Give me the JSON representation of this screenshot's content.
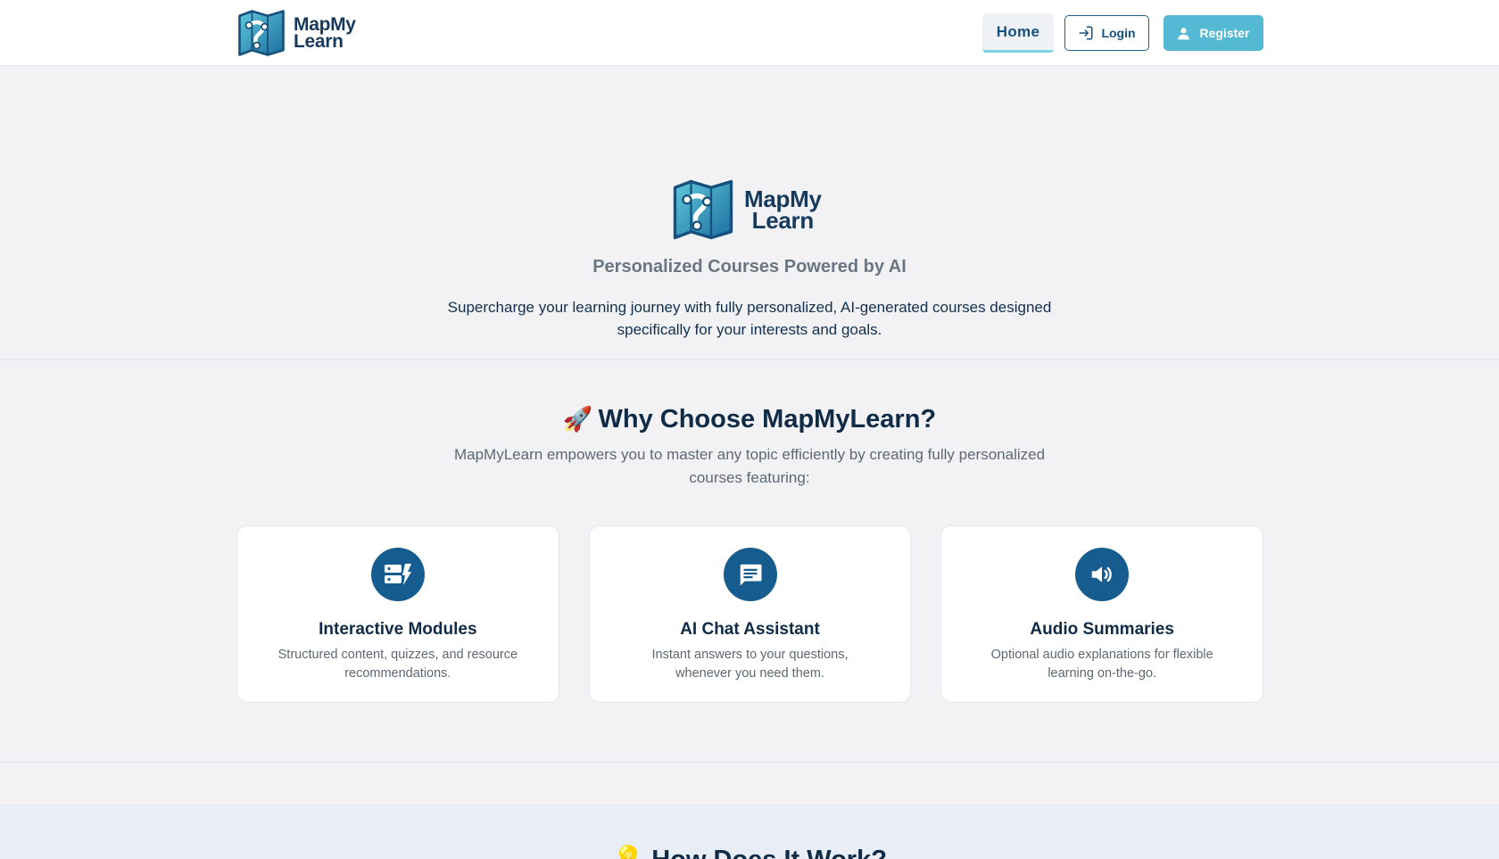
{
  "brand": {
    "name_line1": "MapMy",
    "name_line2": "Learn"
  },
  "nav": {
    "home": "Home",
    "login": "Login",
    "register": "Register"
  },
  "hero": {
    "tagline": "Personalized Courses Powered by AI",
    "description": "Supercharge your learning journey with fully personalized, AI-generated courses designed specifically for your interests and goals."
  },
  "why": {
    "emoji": "🚀",
    "title": "Why Choose MapMyLearn?",
    "description": "MapMyLearn empowers you to master any topic efficiently by creating fully personalized courses featuring:",
    "features": [
      {
        "icon": "modules-icon",
        "title": "Interactive Modules",
        "text": "Structured content, quizzes, and resource recommendations."
      },
      {
        "icon": "chat-icon",
        "title": "AI Chat Assistant",
        "text": "Instant answers to your questions, whenever you need them."
      },
      {
        "icon": "audio-icon",
        "title": "Audio Summaries",
        "text": "Optional audio explanations for flexible learning on-the-go."
      }
    ]
  },
  "how": {
    "emoji": "💡",
    "title": "How Does It Work?"
  },
  "colors": {
    "primary": "#175c8e",
    "accent": "#54b9d2",
    "background": "#f2f2f5"
  }
}
